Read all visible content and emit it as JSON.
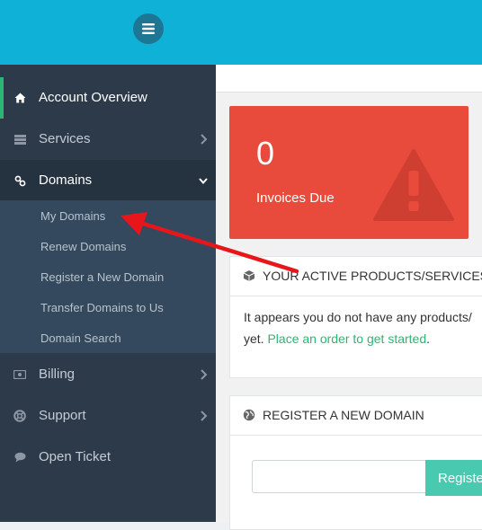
{
  "header": {
    "menu_icon": "hamburger-icon"
  },
  "sidebar": {
    "items": [
      {
        "label": "Account Overview",
        "icon": "home-icon"
      },
      {
        "label": "Services",
        "icon": "server-icon"
      },
      {
        "label": "Domains",
        "icon": "link-icon"
      },
      {
        "label": "Billing",
        "icon": "money-icon"
      },
      {
        "label": "Support",
        "icon": "lifebuoy-icon"
      },
      {
        "label": "Open Ticket",
        "icon": "comment-icon"
      }
    ],
    "domains_submenu": [
      "My Domains",
      "Renew Domains",
      "Register a New Domain",
      "Transfer Domains to Us",
      "Domain Search"
    ]
  },
  "invoices": {
    "count": "0",
    "label": "Invoices Due"
  },
  "products_panel": {
    "title": "YOUR ACTIVE PRODUCTS/SERVICES",
    "text_line1": "It appears you do not have any products/",
    "text_line2_prefix": "yet. ",
    "link": "Place an order to get started",
    "text_line2_suffix": "."
  },
  "domain_panel": {
    "title": "REGISTER A NEW DOMAIN",
    "input_value": "",
    "button_label": "Register"
  },
  "colors": {
    "topbar": "#0fb1d6",
    "sidebar": "#2c3a49",
    "invoice_tile": "#e84b3c",
    "accent_green": "#2bb673",
    "annotation_arrow": "#e8151b"
  }
}
